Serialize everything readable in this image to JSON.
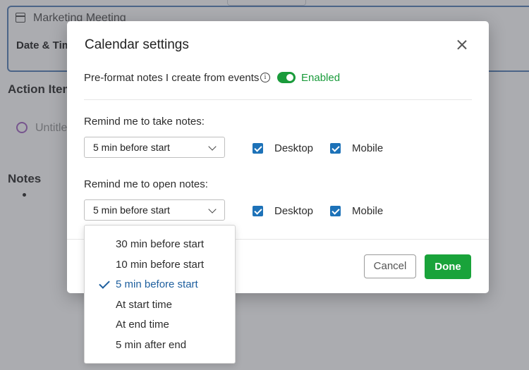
{
  "background": {
    "meeting_title": "Marketing Meeting",
    "date_time_label": "Date & Tim",
    "action_items_label": "Action Item",
    "untitled_label": "Untitle",
    "notes_label": "Notes"
  },
  "dialog": {
    "title": "Calendar settings",
    "preformat": {
      "label": "Pre-format notes I create from events",
      "info_icon": "info-icon",
      "toggle_state": "Enabled",
      "toggle_color": "#1a9b3b"
    },
    "take_notes": {
      "label": "Remind me to take notes:",
      "select_value": "5 min before start",
      "desktop_label": "Desktop",
      "mobile_label": "Mobile"
    },
    "open_notes": {
      "label": "Remind me to open notes:",
      "select_value": "5 min before start",
      "desktop_label": "Desktop",
      "mobile_label": "Mobile"
    },
    "cancel_label": "Cancel",
    "done_label": "Done",
    "done_color": "#19a33a",
    "checkbox_color": "#1d72b8"
  },
  "dropdown": {
    "options": [
      "30 min before start",
      "10 min before start",
      "5 min before start",
      "At start time",
      "At end time",
      "5 min after end"
    ],
    "selected": "5 min before start"
  }
}
